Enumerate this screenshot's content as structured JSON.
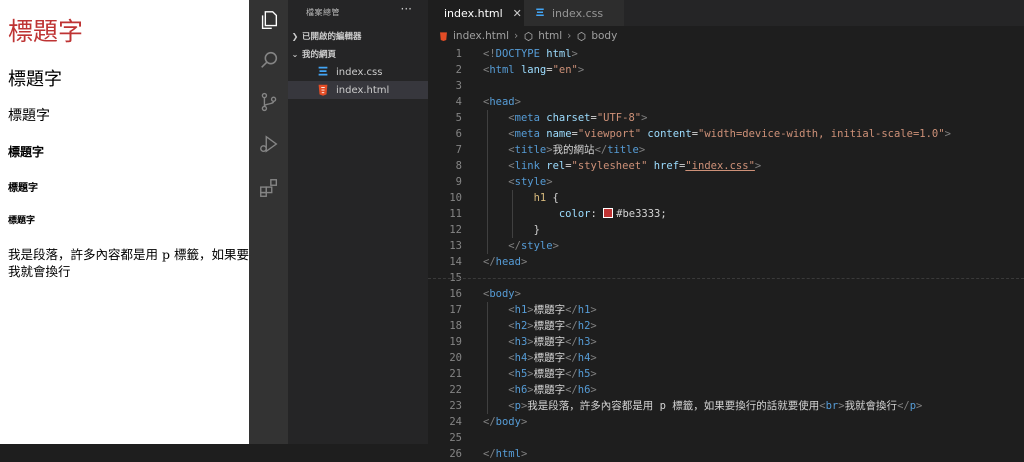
{
  "preview": {
    "h1": "標題字",
    "h2": "標題字",
    "h3": "標題字",
    "h4": "標題字",
    "h5": "標題字",
    "h6": "標題字",
    "paragraph_line1": "我是段落，許多內容都是用 p 標籤，如果要",
    "paragraph_line2": "我就會換行",
    "h1_color": "#be3333"
  },
  "activitybar": {
    "items": [
      "explorer-icon",
      "search-icon",
      "source-control-icon",
      "run-debug-icon",
      "extensions-icon"
    ]
  },
  "sidebar": {
    "title": "檔案總管",
    "more": "···",
    "open_editors": "已開啟的編輯器",
    "folder": "我的網頁",
    "files": [
      "index.css",
      "index.html"
    ]
  },
  "tabs": [
    {
      "label": "index.html",
      "close": "✕",
      "active": true
    },
    {
      "label": "index.css",
      "active": false
    }
  ],
  "breadcrumb": [
    "index.html",
    "html",
    "body"
  ],
  "code": {
    "lines": [
      {
        "n": "1",
        "parts": [
          [
            "brk",
            "<!"
          ],
          [
            "tagc",
            "DOCTYPE"
          ],
          [
            "txt",
            " "
          ],
          [
            "attr",
            "html"
          ],
          [
            "brk",
            ">"
          ]
        ]
      },
      {
        "n": "2",
        "parts": [
          [
            "brk",
            "<"
          ],
          [
            "tagc",
            "html"
          ],
          [
            "txt",
            " "
          ],
          [
            "attr",
            "lang"
          ],
          [
            "txt",
            "="
          ],
          [
            "str",
            "\"en\""
          ],
          [
            "brk",
            ">"
          ]
        ]
      },
      {
        "n": "3",
        "parts": []
      },
      {
        "n": "4",
        "parts": [
          [
            "brk",
            "<"
          ],
          [
            "tagc",
            "head"
          ],
          [
            "brk",
            ">"
          ]
        ]
      },
      {
        "n": "5",
        "parts": [
          [
            "txt",
            "    "
          ],
          [
            "brk",
            "<"
          ],
          [
            "tagc",
            "meta"
          ],
          [
            "txt",
            " "
          ],
          [
            "attr",
            "charset"
          ],
          [
            "txt",
            "="
          ],
          [
            "str",
            "\"UTF-8\""
          ],
          [
            "brk",
            ">"
          ]
        ]
      },
      {
        "n": "6",
        "parts": [
          [
            "txt",
            "    "
          ],
          [
            "brk",
            "<"
          ],
          [
            "tagc",
            "meta"
          ],
          [
            "txt",
            " "
          ],
          [
            "attr",
            "name"
          ],
          [
            "txt",
            "="
          ],
          [
            "str",
            "\"viewport\""
          ],
          [
            "txt",
            " "
          ],
          [
            "attr",
            "content"
          ],
          [
            "txt",
            "="
          ],
          [
            "str",
            "\"width=device-width, initial-scale=1.0\""
          ],
          [
            "brk",
            ">"
          ]
        ]
      },
      {
        "n": "7",
        "parts": [
          [
            "txt",
            "    "
          ],
          [
            "brk",
            "<"
          ],
          [
            "tagc",
            "title"
          ],
          [
            "brk",
            ">"
          ],
          [
            "txt",
            "我的網站"
          ],
          [
            "brk",
            "</"
          ],
          [
            "tagc",
            "title"
          ],
          [
            "brk",
            ">"
          ]
        ]
      },
      {
        "n": "8",
        "parts": [
          [
            "txt",
            "    "
          ],
          [
            "brk",
            "<"
          ],
          [
            "tagc",
            "link"
          ],
          [
            "txt",
            " "
          ],
          [
            "attr",
            "rel"
          ],
          [
            "txt",
            "="
          ],
          [
            "str",
            "\"stylesheet\""
          ],
          [
            "txt",
            " "
          ],
          [
            "attr",
            "href"
          ],
          [
            "txt",
            "="
          ],
          [
            "str",
            "\"index.css\""
          ],
          [
            "brk",
            ">"
          ]
        ]
      },
      {
        "n": "9",
        "parts": [
          [
            "txt",
            "    "
          ],
          [
            "brk",
            "<"
          ],
          [
            "tagc",
            "style"
          ],
          [
            "brk",
            ">"
          ]
        ]
      },
      {
        "n": "10",
        "parts": [
          [
            "txt",
            "        "
          ],
          [
            "sel",
            "h1"
          ],
          [
            "txt",
            " {"
          ]
        ]
      },
      {
        "n": "11",
        "parts": [
          [
            "txt",
            "            "
          ],
          [
            "prop",
            "color"
          ],
          [
            "txt",
            ": "
          ],
          [
            "swatch",
            ""
          ],
          [
            "txt",
            "#be3333;"
          ]
        ]
      },
      {
        "n": "12",
        "parts": [
          [
            "txt",
            "        }"
          ]
        ]
      },
      {
        "n": "13",
        "parts": [
          [
            "txt",
            "    "
          ],
          [
            "brk",
            "</"
          ],
          [
            "tagc",
            "style"
          ],
          [
            "brk",
            ">"
          ]
        ]
      },
      {
        "n": "14",
        "parts": [
          [
            "brk",
            "</"
          ],
          [
            "tagc",
            "head"
          ],
          [
            "brk",
            ">"
          ]
        ]
      },
      {
        "n": "15",
        "parts": []
      },
      {
        "n": "16",
        "parts": [
          [
            "brk",
            "<"
          ],
          [
            "tagc",
            "body"
          ],
          [
            "brk",
            ">"
          ]
        ]
      },
      {
        "n": "17",
        "parts": [
          [
            "txt",
            "    "
          ],
          [
            "brk",
            "<"
          ],
          [
            "tagc",
            "h1"
          ],
          [
            "brk",
            ">"
          ],
          [
            "txt",
            "標題字"
          ],
          [
            "brk",
            "</"
          ],
          [
            "tagc",
            "h1"
          ],
          [
            "brk",
            ">"
          ]
        ]
      },
      {
        "n": "18",
        "parts": [
          [
            "txt",
            "    "
          ],
          [
            "brk",
            "<"
          ],
          [
            "tagc",
            "h2"
          ],
          [
            "brk",
            ">"
          ],
          [
            "txt",
            "標題字"
          ],
          [
            "brk",
            "</"
          ],
          [
            "tagc",
            "h2"
          ],
          [
            "brk",
            ">"
          ]
        ]
      },
      {
        "n": "19",
        "parts": [
          [
            "txt",
            "    "
          ],
          [
            "brk",
            "<"
          ],
          [
            "tagc",
            "h3"
          ],
          [
            "brk",
            ">"
          ],
          [
            "txt",
            "標題字"
          ],
          [
            "brk",
            "</"
          ],
          [
            "tagc",
            "h3"
          ],
          [
            "brk",
            ">"
          ]
        ]
      },
      {
        "n": "20",
        "parts": [
          [
            "txt",
            "    "
          ],
          [
            "brk",
            "<"
          ],
          [
            "tagc",
            "h4"
          ],
          [
            "brk",
            ">"
          ],
          [
            "txt",
            "標題字"
          ],
          [
            "brk",
            "</"
          ],
          [
            "tagc",
            "h4"
          ],
          [
            "brk",
            ">"
          ]
        ]
      },
      {
        "n": "21",
        "parts": [
          [
            "txt",
            "    "
          ],
          [
            "brk",
            "<"
          ],
          [
            "tagc",
            "h5"
          ],
          [
            "brk",
            ">"
          ],
          [
            "txt",
            "標題字"
          ],
          [
            "brk",
            "</"
          ],
          [
            "tagc",
            "h5"
          ],
          [
            "brk",
            ">"
          ]
        ]
      },
      {
        "n": "22",
        "parts": [
          [
            "txt",
            "    "
          ],
          [
            "brk",
            "<"
          ],
          [
            "tagc",
            "h6"
          ],
          [
            "brk",
            ">"
          ],
          [
            "txt",
            "標題字"
          ],
          [
            "brk",
            "</"
          ],
          [
            "tagc",
            "h6"
          ],
          [
            "brk",
            ">"
          ]
        ]
      },
      {
        "n": "23",
        "parts": [
          [
            "txt",
            "    "
          ],
          [
            "brk",
            "<"
          ],
          [
            "tagc",
            "p"
          ],
          [
            "brk",
            ">"
          ],
          [
            "txt",
            "我是段落，許多內容都是用 p 標籤，如果要換行的話就要使用"
          ],
          [
            "brk",
            "<"
          ],
          [
            "tagc",
            "br"
          ],
          [
            "brk",
            ">"
          ],
          [
            "txt",
            "我就會換行"
          ],
          [
            "brk",
            "</"
          ],
          [
            "tagc",
            "p"
          ],
          [
            "brk",
            ">"
          ]
        ]
      },
      {
        "n": "24",
        "parts": [
          [
            "brk",
            "</"
          ],
          [
            "tagc",
            "body"
          ],
          [
            "brk",
            ">"
          ]
        ]
      },
      {
        "n": "25",
        "parts": []
      },
      {
        "n": "26",
        "parts": [
          [
            "brk",
            "</"
          ],
          [
            "tagc",
            "html"
          ],
          [
            "brk",
            ">"
          ]
        ]
      }
    ],
    "swatch_color": "#be3333"
  },
  "colors": {
    "accent_html_icon": "#e44d26",
    "accent_css_icon": "#42a5f5"
  }
}
